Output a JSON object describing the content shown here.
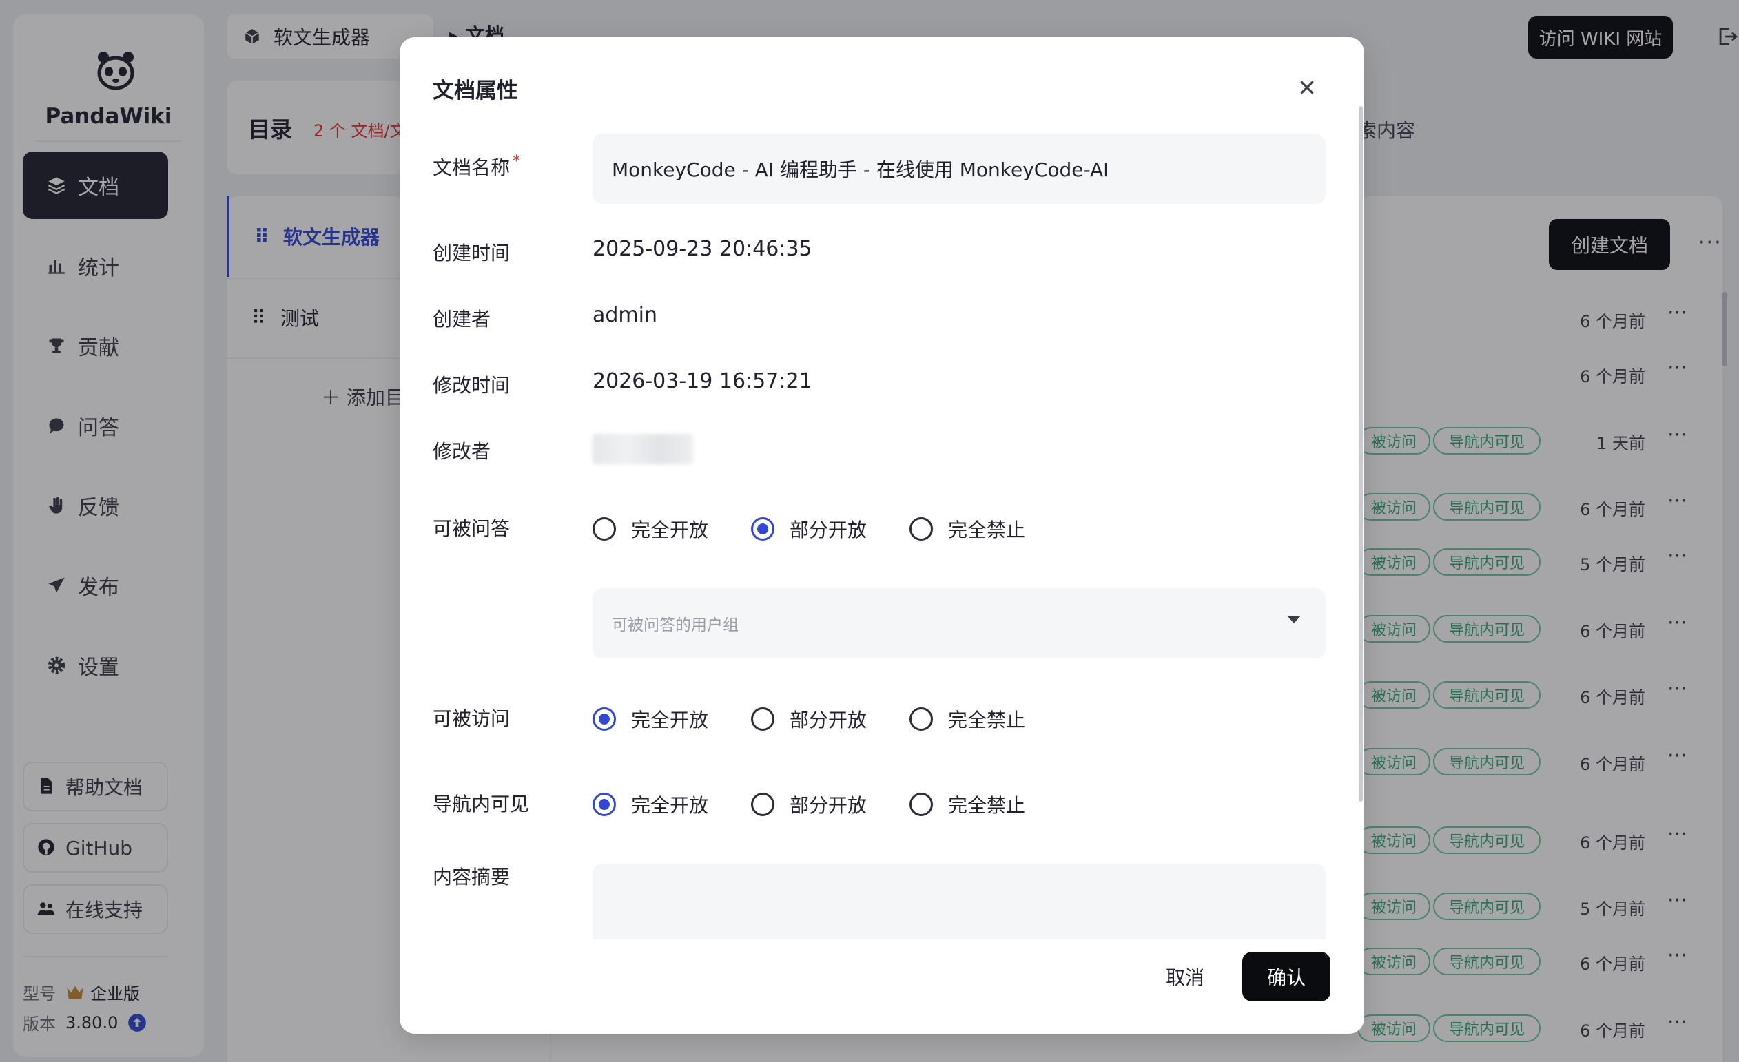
{
  "sidebar": {
    "brand": "PandaWiki",
    "nav": [
      {
        "label": "文档"
      },
      {
        "label": "统计"
      },
      {
        "label": "贡献"
      },
      {
        "label": "问答"
      },
      {
        "label": "反馈"
      },
      {
        "label": "发布"
      },
      {
        "label": "设置"
      }
    ],
    "links": [
      {
        "label": "帮助文档"
      },
      {
        "label": "GitHub"
      },
      {
        "label": "在线支持"
      }
    ],
    "edition_label": "型号",
    "edition_value": "企业版",
    "version_label": "版本",
    "version_value": "3.80.0"
  },
  "header": {
    "kb_name": "软文生成器",
    "crumb_current": "文档",
    "visit_wiki": "访问 WIKI 网站"
  },
  "directory": {
    "title": "目录",
    "count": "2 个 文档/文",
    "search_hint": "索内容",
    "items": [
      {
        "label": "软文生成器"
      },
      {
        "label": "测试"
      }
    ],
    "add_label": "添加目"
  },
  "list": {
    "create_label": "创建文档",
    "more": "···",
    "tag_access": "被访问",
    "tag_nav": "导航内可见",
    "rows": [
      {
        "time": "6 个月前"
      },
      {
        "time": "6 个月前"
      },
      {
        "time": "1 天前"
      },
      {
        "time": "6 个月前"
      },
      {
        "time": "5 个月前"
      },
      {
        "time": "6 个月前"
      },
      {
        "time": "6 个月前"
      },
      {
        "time": "6 个月前"
      },
      {
        "time": "6 个月前"
      },
      {
        "time": "5 个月前"
      },
      {
        "time": "6 个月前"
      },
      {
        "time": "6 个月前"
      }
    ]
  },
  "modal": {
    "title": "文档属性",
    "name_label": "文档名称",
    "required_mark": "*",
    "name_value": "MonkeyCode - AI 编程助手 - 在线使用 MonkeyCode-AI",
    "created_label": "创建时间",
    "created_value": "2025-09-23 20:46:35",
    "creator_label": "创建者",
    "creator_value": "admin",
    "modified_label": "修改时间",
    "modified_value": "2026-03-19 16:57:21",
    "modifier_label": "修改者",
    "qa_label": "可被问答",
    "access_label": "可被访问",
    "nav_label": "导航内可见",
    "summary_label": "内容摘要",
    "options": {
      "open": "完全开放",
      "partial": "部分开放",
      "forbid": "完全禁止"
    },
    "qa_selected": "partial",
    "access_selected": "open",
    "nav_selected": "open",
    "user_group_placeholder": "可被问答的用户组",
    "cancel": "取消",
    "confirm": "确认"
  }
}
